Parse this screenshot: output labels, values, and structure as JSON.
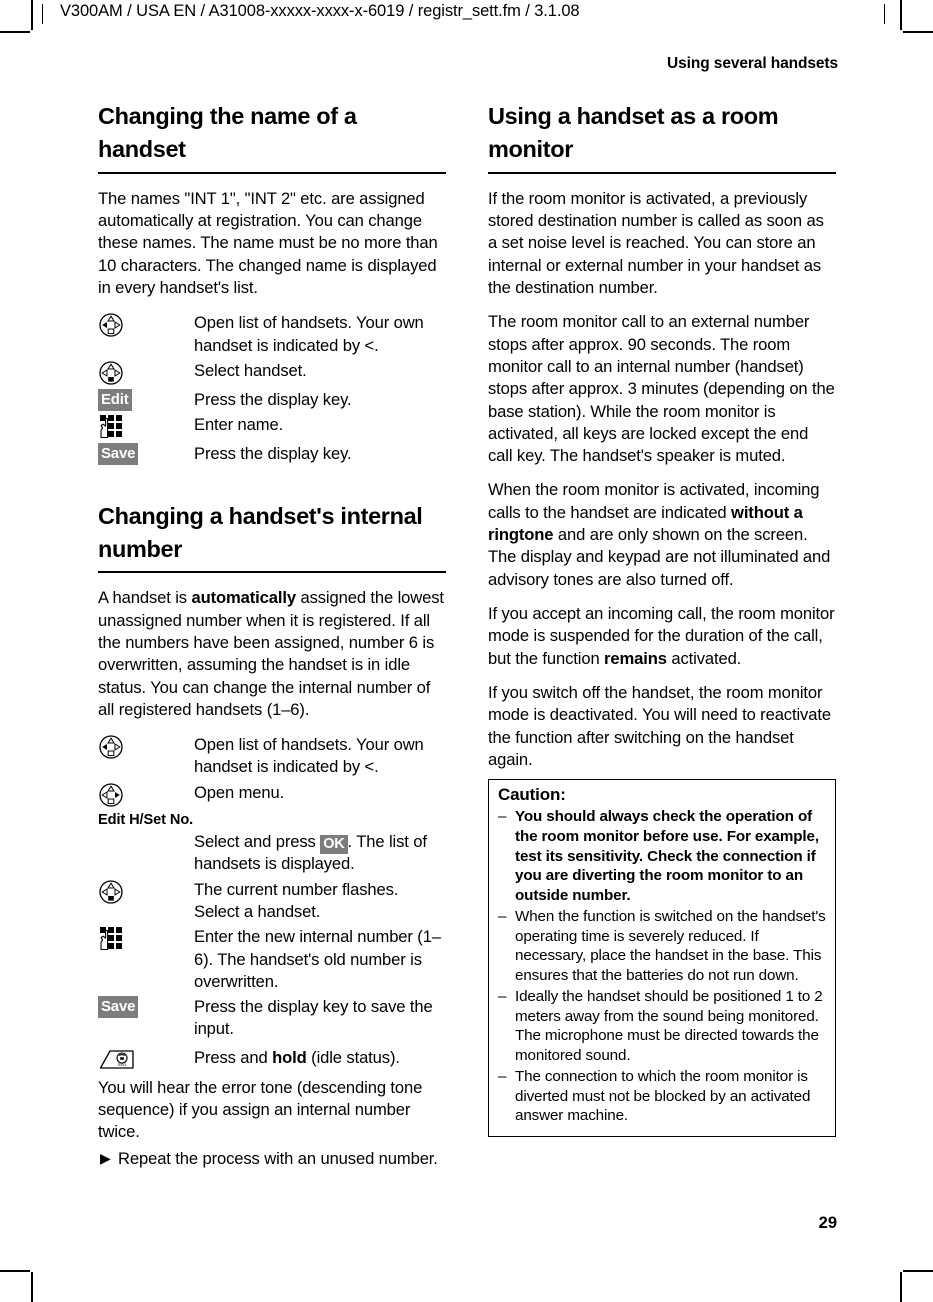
{
  "running_head": {
    "left": "V300AM / USA EN / A31008-xxxxx-xxxx-x-6019 / registr_sett.fm / 3.1.08",
    "right": "Using several handsets"
  },
  "folio": "29",
  "left_column": {
    "section_1": {
      "heading": "Changing the name of a handset",
      "intro": "The names \"INT 1\", \"INT 2\" etc. are assigned automatically at registration. You can change these names. The name must be no more than 10 characters. The changed name is displayed in every handset's list.",
      "steps": [
        {
          "icon": "control-key-left-icon",
          "key_type": "navkey",
          "key_dir": "left",
          "text": "Open list of handsets. Your own handset is indicated by <."
        },
        {
          "icon": "control-key-down-icon",
          "key_type": "navkey",
          "key_dir": "down",
          "text": "Select handset."
        },
        {
          "icon": "display-key-icon",
          "key_type": "dkey",
          "key_label": "Edit",
          "text": "Press the display key."
        },
        {
          "icon": "keypad-icon",
          "key_type": "keypad",
          "text": "Enter name."
        },
        {
          "icon": "display-key-icon",
          "key_type": "dkey",
          "key_label": "Save",
          "text": "Press the display key."
        }
      ]
    },
    "section_2": {
      "heading": "Changing a handset's internal number",
      "intro_a": "A handset is ",
      "intro_bold": "automatically",
      "intro_b": " assigned the lowest unassigned number when it is registered. If all the numbers have been assigned, number 6 is overwritten, assuming the handset is in idle status. You can change the internal number of all registered handsets (1–6).",
      "steps_1": [
        {
          "icon": "control-key-left-icon",
          "key_type": "navkey",
          "key_dir": "left",
          "text": "Open list of handsets. Your own handset is indicated by <."
        },
        {
          "icon": "control-key-right-icon",
          "key_type": "navkey",
          "key_dir": "right",
          "text": "Open menu."
        }
      ],
      "menu_path": "Edit H/Set No.",
      "step_select_a": "Select and press ",
      "step_select_key": "OK",
      "step_select_b": ". The list of handsets is displayed.",
      "steps_2": [
        {
          "icon": "control-key-down-icon",
          "key_type": "navkey",
          "key_dir": "down",
          "text": "The current number flashes. Select a handset."
        },
        {
          "icon": "keypad-icon",
          "key_type": "keypad",
          "text": "Enter the new internal number (1–6). The handset's old number is overwritten."
        },
        {
          "icon": "display-key-icon",
          "key_type": "dkey",
          "key_label": "Save",
          "text": "Press the display key to save the input."
        }
      ],
      "step_end_a": "Press and ",
      "step_end_bold": "hold",
      "step_end_b": " (idle status).",
      "step_end_icon": "end-call-key-icon",
      "outro": "You will hear the error tone (descending tone sequence) if you assign an internal number twice.",
      "arrow_item": "Repeat the process with an unused number."
    }
  },
  "right_column": {
    "section": {
      "heading": "Using a handset as a room monitor",
      "paragraphs": [
        "If the room monitor is activated, a previously stored destination number is called as soon as a set noise level is reached. You can store an internal or external number in your handset as the destination number.",
        "The room monitor call to an external number stops after approx. 90 seconds. The room monitor call to an internal number (handset) stops after approx. 3 minutes (depending on the base station). While the room monitor is activated, all keys are locked except the end call key. The handset's speaker is muted."
      ],
      "para_ringtone_a": "When the room monitor is activated, incoming calls to the handset are indicated ",
      "para_ringtone_bold": "without a ringtone",
      "para_ringtone_b": " and are only shown on the screen. The display and keypad are not illuminated and advisory tones are also turned off.",
      "para_remains_a": "If you accept an incoming call, the room monitor mode is suspended for the duration of the call, but the function ",
      "para_remains_bold": "remains",
      "para_remains_b": " activated.",
      "para_switchoff": "If you switch off the handset, the room monitor mode is deactivated. You will need to reactivate the function after switching on the handset again."
    },
    "caution": {
      "title": "Caution:",
      "items": [
        {
          "dash": "–",
          "text": "You should always check the operation of the room monitor before use. For example, test its sensitivity. Check the connection if you are diverting the room monitor to an outside number.",
          "bold": true
        },
        {
          "dash": "–",
          "text": "When the function is switched on the handset's operating time is severely reduced. If necessary, place the handset in the base. This ensures that the batteries do not run down.",
          "bold": false
        },
        {
          "dash": "–",
          "text": "Ideally the handset should be positioned 1 to 2 meters away from the sound being monitored. The microphone must be directed towards the monitored sound.",
          "bold": false
        },
        {
          "dash": "–",
          "text": "The connection to which the room monitor is diverted must not be blocked by an activated answer machine.",
          "bold": false
        }
      ]
    }
  },
  "colors": {
    "display_key_bg": "#7d7d7d",
    "display_key_fg": "#ffffff",
    "rule": "#000000",
    "text": "#000000"
  }
}
